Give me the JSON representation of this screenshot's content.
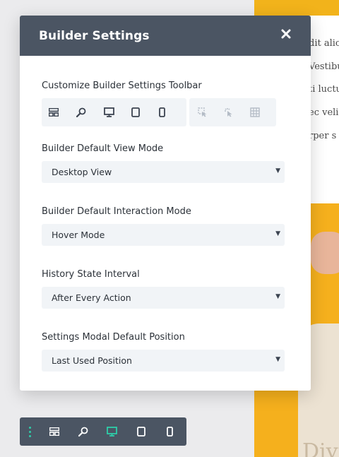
{
  "background": {
    "text_lines": [
      "dit alic",
      "Vestibu",
      "ti luctu",
      "ec velit",
      "rper s"
    ],
    "hero_text": "Divi"
  },
  "modal": {
    "title": "Builder Settings",
    "close_icon": "close-icon",
    "toolbar_section": {
      "label": "Customize Builder Settings Toolbar",
      "group1_icons": [
        "wireframe-icon",
        "zoom-icon",
        "desktop-icon",
        "tablet-icon",
        "phone-icon"
      ],
      "group2_icons": [
        "click-mode-icon",
        "hover-mode-icon",
        "grid-mode-icon"
      ]
    },
    "view_mode": {
      "label": "Builder Default View Mode",
      "value": "Desktop View"
    },
    "interaction_mode": {
      "label": "Builder Default Interaction Mode",
      "value": "Hover Mode"
    },
    "history": {
      "label": "History State Interval",
      "value": "After Every Action"
    },
    "position": {
      "label": "Settings Modal Default Position",
      "value": "Last Used Position"
    }
  },
  "bottom_toolbar": {
    "icons": [
      "drag-handle-icon",
      "wireframe-icon",
      "zoom-icon",
      "desktop-icon",
      "tablet-icon",
      "phone-icon"
    ],
    "active": "desktop-icon"
  },
  "colors": {
    "header": "#4b5563",
    "accent": "#2ecfa9",
    "field_bg": "#f1f4f7",
    "hero": "#f5b01d"
  }
}
